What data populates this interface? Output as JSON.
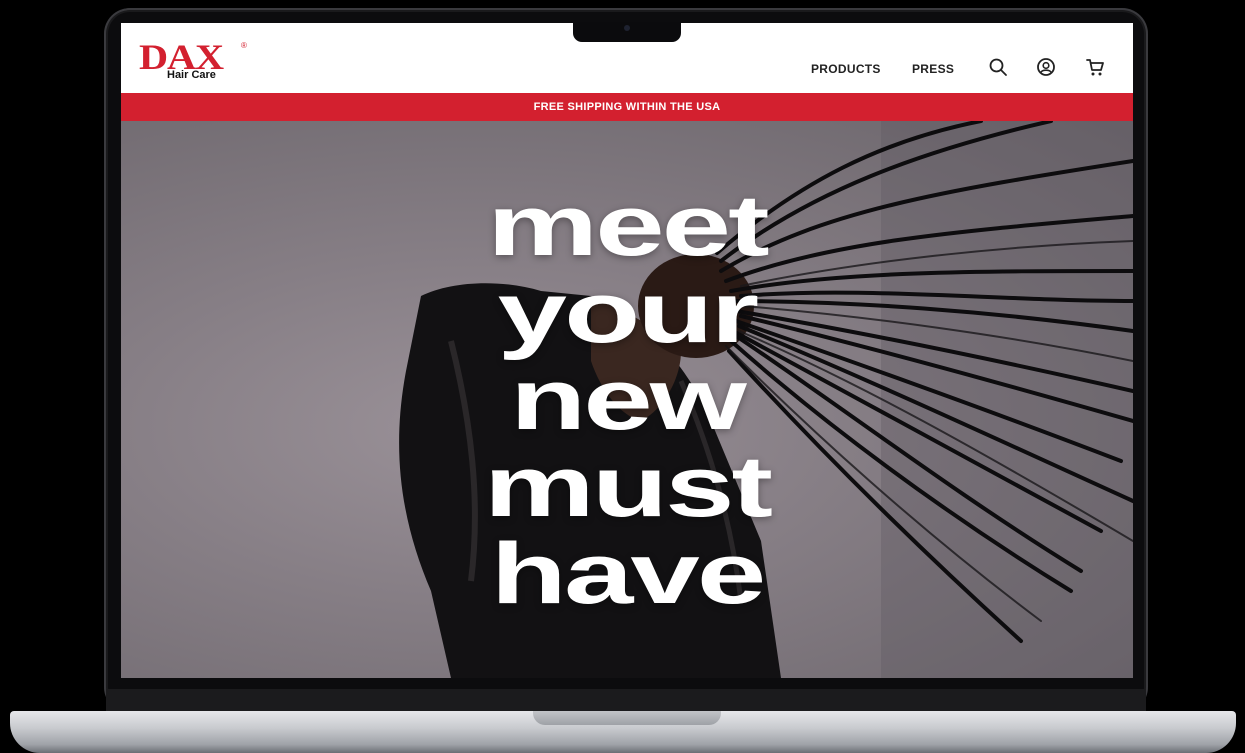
{
  "brand": {
    "name": "DAX",
    "registered": "®",
    "subline": "Hair Care",
    "color": "#d3202f"
  },
  "nav": {
    "items": [
      {
        "label": "PRODUCTS"
      },
      {
        "label": "PRESS"
      }
    ],
    "icons": [
      "search-icon",
      "account-icon",
      "cart-icon"
    ]
  },
  "promo": {
    "text": "FREE SHIPPING WITHIN THE USA",
    "background": "#d3202f"
  },
  "hero": {
    "lines": [
      "meet",
      "your",
      "new",
      "must",
      "have"
    ]
  }
}
